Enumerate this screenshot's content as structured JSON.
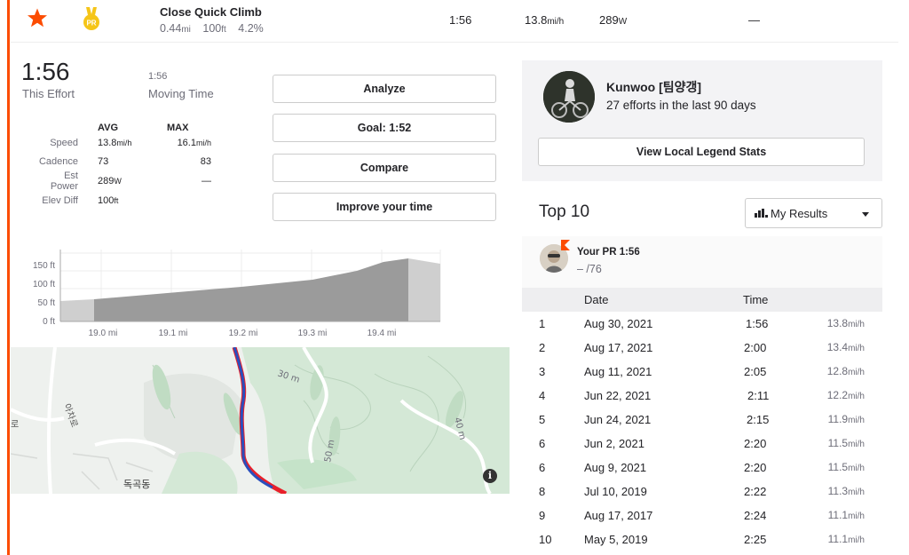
{
  "segment": {
    "name": "Close Quick Climb",
    "distance": "0.44",
    "distance_unit": "mi",
    "elevation": "100",
    "elevation_unit": "ft",
    "grade": "4.2%",
    "time": "1:56",
    "speed": "13.8",
    "speed_unit": "mi/h",
    "power": "289",
    "power_unit": "W",
    "dash": "—",
    "pr_badge": "PR"
  },
  "effort": {
    "time": "1:56",
    "time_label": "This Effort",
    "moving_time": "1:56",
    "moving_label": "Moving Time",
    "headers": {
      "avg": "AVG",
      "max": "MAX"
    },
    "rows": [
      {
        "label": "Speed",
        "avg": "13.8",
        "avg_unit": "mi/h",
        "max": "16.1",
        "max_unit": "mi/h"
      },
      {
        "label": "Cadence",
        "avg": "73",
        "avg_unit": "",
        "max": "83",
        "max_unit": ""
      },
      {
        "label": "Est Power",
        "avg": "289",
        "avg_unit": "W",
        "max": "—",
        "max_unit": ""
      },
      {
        "label": "Elev Diff",
        "avg": "100",
        "avg_unit": "ft",
        "max": "",
        "max_unit": ""
      }
    ]
  },
  "actions": {
    "analyze": "Analyze",
    "goal": "Goal: 1:52",
    "compare": "Compare",
    "improve": "Improve your time"
  },
  "elevation_chart": {
    "y_ticks": [
      "150 ft",
      "100 ft",
      "50 ft",
      "0 ft"
    ],
    "x_ticks": [
      "19.0 mi",
      "19.1 mi",
      "19.2 mi",
      "19.3 mi",
      "19.4 mi"
    ]
  },
  "map": {
    "labels": [
      "30 m",
      "40 m",
      "50 m",
      "독곡동",
      "아차로",
      "로"
    ],
    "info": "i",
    "colors": {
      "route_red": "#e8202a",
      "route_blue": "#2a4fbd",
      "park": "#d4e8d6"
    }
  },
  "local_legend": {
    "name": "Kunwoo [팀양갱]",
    "efforts": "27 efforts in the last 90 days",
    "button": "View Local Legend Stats"
  },
  "top10": {
    "title": "Top 10",
    "filter": "My Results",
    "pr_label": "Your PR 1:56",
    "pr_rank": "– /76",
    "headers": {
      "date": "Date",
      "time": "Time"
    },
    "rows": [
      {
        "rank": "1",
        "date": "Aug 30, 2021",
        "time": "1:56",
        "speed": "13.8"
      },
      {
        "rank": "2",
        "date": "Aug 17, 2021",
        "time": "2:00",
        "speed": "13.4"
      },
      {
        "rank": "3",
        "date": "Aug 11, 2021",
        "time": "2:05",
        "speed": "12.8"
      },
      {
        "rank": "4",
        "date": "Jun 22, 2021",
        "time": "2:11",
        "speed": "12.2"
      },
      {
        "rank": "5",
        "date": "Jun 24, 2021",
        "time": "2:15",
        "speed": "11.9"
      },
      {
        "rank": "6",
        "date": "Jun 2, 2021",
        "time": "2:20",
        "speed": "11.5"
      },
      {
        "rank": "6",
        "date": "Aug 9, 2021",
        "time": "2:20",
        "speed": "11.5"
      },
      {
        "rank": "8",
        "date": "Jul 10, 2019",
        "time": "2:22",
        "speed": "11.3"
      },
      {
        "rank": "9",
        "date": "Aug 17, 2017",
        "time": "2:24",
        "speed": "11.1"
      },
      {
        "rank": "10",
        "date": "May 5, 2019",
        "time": "2:25",
        "speed": "11.1"
      }
    ],
    "speed_unit": "mi/h"
  },
  "colors": {
    "accent": "#fc4c02",
    "medal": "#f5c518",
    "text": "#242428",
    "muted": "#6d6d78"
  }
}
